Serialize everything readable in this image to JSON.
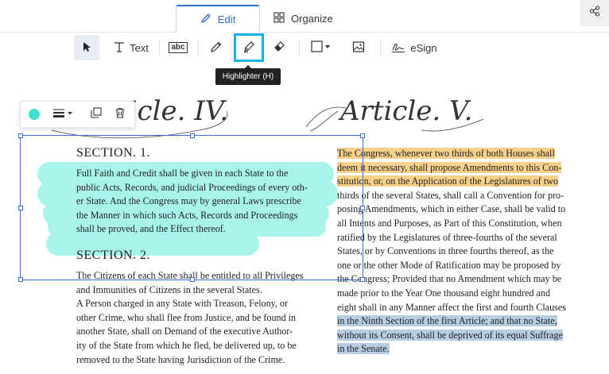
{
  "tabs": {
    "edit": "Edit",
    "organize": "Organize"
  },
  "icons": {
    "share": "share-icon",
    "edit": "pencil-icon",
    "organize": "grid-icon"
  },
  "toolbar": {
    "select": "pointer-icon",
    "text_label": "Text",
    "ocr": "abc",
    "pencil": "pencil-icon",
    "highlighter": "highlighter-icon",
    "eraser": "eraser-icon",
    "shape": "rectangle-icon",
    "image": "image-icon",
    "esign_label": "eSign"
  },
  "tooltip": "Highlighter (H)",
  "context_menu": {
    "color": "#3fe0d0",
    "items": [
      "color-dot-icon",
      "line-weight-icon",
      "duplicate-icon",
      "trash-icon"
    ]
  },
  "document": {
    "title_left": "ticle. IV.",
    "title_right": "Article. V.",
    "section1": "SECTION. 1.",
    "section1_lines": [
      "Full Faith and Credit shall be given in each State to the",
      "public Acts, Records, and judicial Proceedings of every oth-",
      "er State. And the Congress may by general Laws prescribe",
      "the Manner in which such Acts, Records and Proceedings",
      "shall be proved, and the Effect thereof."
    ],
    "section2": "SECTION. 2.",
    "section2_lines": [
      "The Citizens of each State shall be entitled to all Privileges",
      "and Immunities of Citizens in the several States.",
      "A Person charged in any State with Treason, Felony, or",
      "other Crime, who shall flee from Justice, and be found in",
      "another State, shall on Demand of the executive Author-",
      "ity of the State from which he fled, be delivered up, to be",
      "removed to the State having Jurisdiction of the Crime."
    ],
    "article5_lines": [
      "The Congress, whenever two thirds of both Houses shall",
      "deem it necessary, shall propose Amendments to this Con-",
      "stitution, or, on the Application of the Legislatures of two",
      "thirds of the several States, shall call a Convention for pro-",
      "posing Amendments, which in either Case, shall be valid to",
      "all Intents and Purposes, as Part of this Constitution, when",
      "ratified by the Legislatures of three-fourths of the several",
      "States, or by Conventions in three fourths thereof, as the",
      "one or the other Mode of Ratification may be proposed by",
      "the Congress; Provided that no Amendment which may be",
      "made prior to the Year One thousand eight hundred and",
      "eight shall in any Manner affect the first and fourth Clauses",
      "in the Ninth Section of the first Article; and that no State,",
      "without its Consent, shall be deprived of its equal Suffrage",
      "in the Senate."
    ],
    "highlight_colors": {
      "yellow": "#f7d08a",
      "blue": "#b7cde3",
      "cyan": "#a8f3ea"
    }
  }
}
